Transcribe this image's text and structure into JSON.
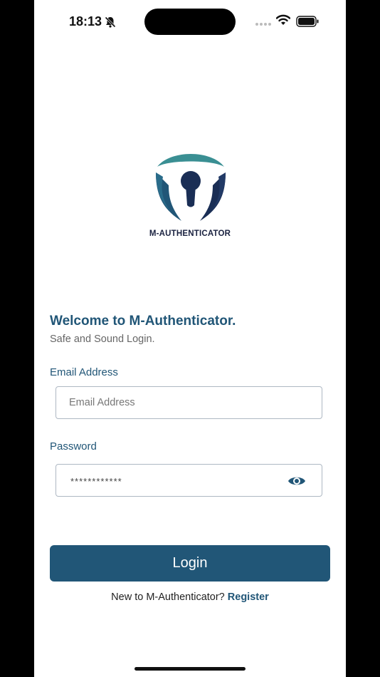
{
  "status_bar": {
    "time": "18:13",
    "icons": [
      "bell-slash-icon",
      "signal-dots-icon",
      "wifi-icon",
      "battery-icon"
    ]
  },
  "logo": {
    "brand_text": "M-AUTHENTICATOR",
    "colors": {
      "teal": "#3a8f93",
      "navy": "#1a2e55",
      "mid": "#215677"
    }
  },
  "welcome": {
    "title": "Welcome to M-Authenticator.",
    "subtitle": "Safe and Sound Login."
  },
  "form": {
    "email": {
      "label": "Email Address",
      "placeholder": "Email Address",
      "value": ""
    },
    "password": {
      "label": "Password",
      "value": "************",
      "toggle_icon": "eye-icon"
    },
    "login_label": "Login"
  },
  "footer": {
    "prompt": "New to M-Authenticator?",
    "register_label": "Register"
  },
  "colors": {
    "primary": "#215677",
    "subtitle_text": "#666666",
    "field_border": "#aeb8c3"
  }
}
